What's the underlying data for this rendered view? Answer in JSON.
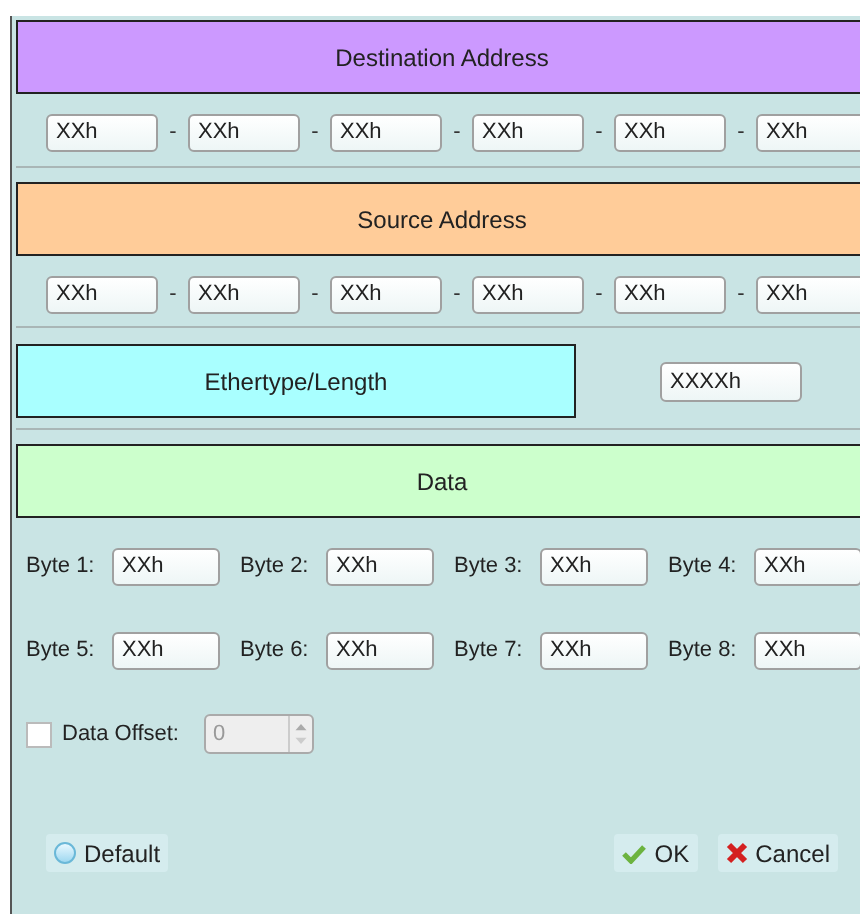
{
  "destination": {
    "title": "Destination Address",
    "fields": [
      "XXh",
      "XXh",
      "XXh",
      "XXh",
      "XXh",
      "XXh"
    ],
    "separator": "-"
  },
  "source": {
    "title": "Source Address",
    "fields": [
      "XXh",
      "XXh",
      "XXh",
      "XXh",
      "XXh",
      "XXh"
    ],
    "separator": "-"
  },
  "ethertype": {
    "title": "Ethertype/Length",
    "value": "XXXXh"
  },
  "data": {
    "title": "Data",
    "bytes": [
      {
        "label": "Byte 1:",
        "value": "XXh"
      },
      {
        "label": "Byte 2:",
        "value": "XXh"
      },
      {
        "label": "Byte 3:",
        "value": "XXh"
      },
      {
        "label": "Byte 4:",
        "value": "XXh"
      },
      {
        "label": "Byte 5:",
        "value": "XXh"
      },
      {
        "label": "Byte 6:",
        "value": "XXh"
      },
      {
        "label": "Byte 7:",
        "value": "XXh"
      },
      {
        "label": "Byte 8:",
        "value": "XXh"
      }
    ]
  },
  "data_offset": {
    "label": "Data Offset:",
    "checked": false,
    "value": "0",
    "disabled": true
  },
  "buttons": [
    {
      "kind": "default",
      "label": "Default"
    },
    {
      "kind": "ok",
      "label": "OK"
    },
    {
      "kind": "cancel",
      "label": "Cancel"
    }
  ]
}
